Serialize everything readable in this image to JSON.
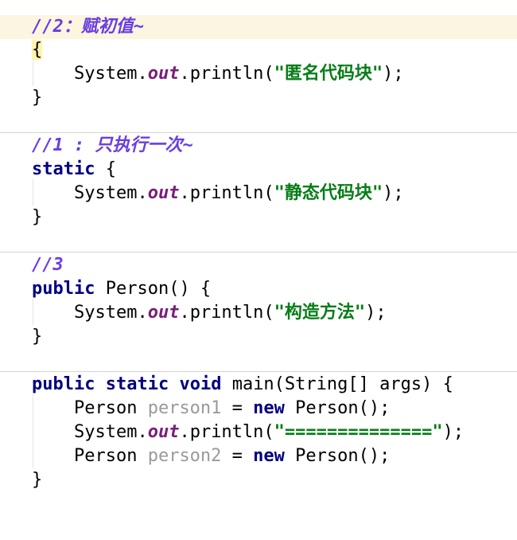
{
  "blocks": [
    {
      "comment": "//2：赋初值~",
      "open": "{",
      "print_prefix": "System.",
      "print_field": "out",
      "print_method": ".println(",
      "print_string": "\"匿名代码块\"",
      "print_suffix": ");",
      "close": "}"
    },
    {
      "comment": "//1 : 只执行一次~",
      "keyword": "static",
      "open": " {",
      "print_prefix": "System.",
      "print_field": "out",
      "print_method": ".println(",
      "print_string": "\"静态代码块\"",
      "print_suffix": ");",
      "close": "}"
    },
    {
      "comment": "//3",
      "keyword": "public",
      "signature": " Person() {",
      "print_prefix": "System.",
      "print_field": "out",
      "print_method": ".println(",
      "print_string": "\"构造方法\"",
      "print_suffix": ");",
      "close": "}"
    }
  ],
  "main_method": {
    "kw_public": "public",
    "kw_static": "static",
    "kw_void": "void",
    "signature": " main(String[] args) {",
    "line1": {
      "type": "Person ",
      "var": "person1",
      "assign": " = ",
      "kw_new": "new",
      "ctor": " Person();"
    },
    "line2": {
      "prefix": "System.",
      "field": "out",
      "method": ".println(",
      "string": "\"==============\"",
      "suffix": ");"
    },
    "line3": {
      "type": "Person ",
      "var": "person2",
      "assign": " = ",
      "kw_new": "new",
      "ctor": " Person();"
    },
    "close": "}"
  },
  "colors": {
    "comment": "#6a3ee0",
    "keyword": "#000080",
    "field": "#7a1e7a",
    "string": "#067d17",
    "unused_variable": "#9a9a9a",
    "current_line": "#fcf5e0"
  }
}
